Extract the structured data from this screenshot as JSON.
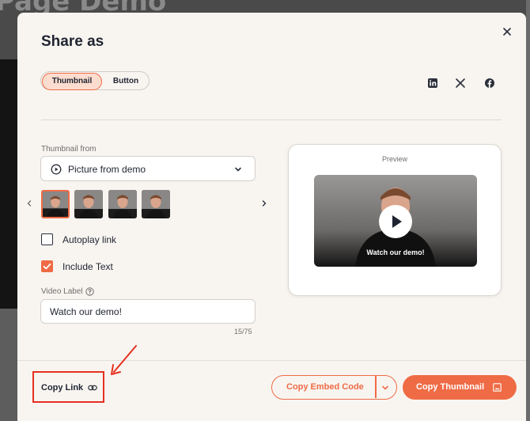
{
  "background": {
    "page_title": "Page Demo"
  },
  "modal": {
    "title": "Share as",
    "tabs": [
      {
        "label": "Thumbnail",
        "selected": true
      },
      {
        "label": "Button",
        "selected": false
      }
    ],
    "social_icons": [
      "linkedin-icon",
      "x-icon",
      "facebook-icon"
    ]
  },
  "thumbnail_from": {
    "label": "Thumbnail from",
    "selected": "Picture from demo",
    "thumbnails_count": 4,
    "selected_index": 0
  },
  "options": {
    "autoplay": {
      "label": "Autoplay link",
      "checked": false
    },
    "include_text": {
      "label": "Include Text",
      "checked": true
    }
  },
  "video_label": {
    "label": "Video Label",
    "value": "Watch our demo!",
    "counter": "15/75"
  },
  "preview": {
    "label": "Preview",
    "caption": "Watch our demo!"
  },
  "footer": {
    "copy_link": "Copy Link",
    "copy_embed": "Copy Embed Code",
    "copy_thumbnail": "Copy Thumbnail"
  },
  "colors": {
    "accent": "#ef6b45",
    "accent_soft": "#fbdccf",
    "highlight_red": "#e6301f",
    "modal_bg": "#f8f5f1"
  }
}
